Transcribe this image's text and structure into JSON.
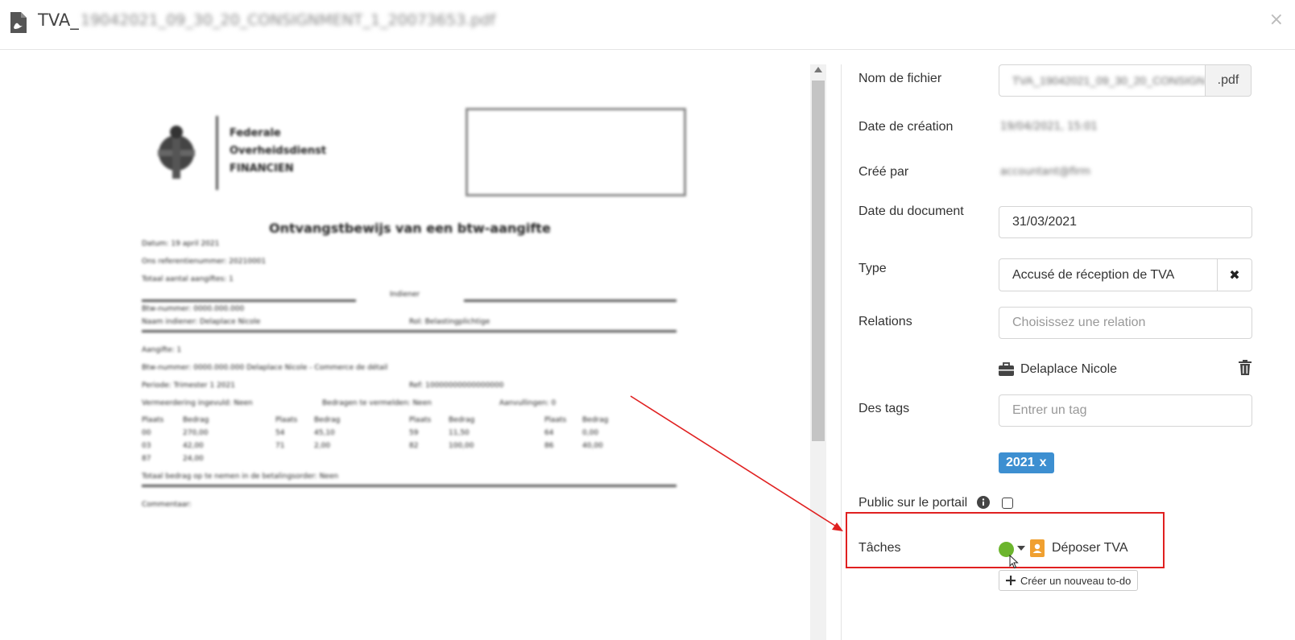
{
  "header": {
    "title_prefix": "TVA_",
    "title_blurred": "19042021_09_30_20_CONSIGNMENT_1_20073653.pdf",
    "close_symbol": "×"
  },
  "document": {
    "org_lines": [
      "Federale",
      "Overheidsdienst",
      "FINANCIEN"
    ],
    "heading": "Ontvangstbewijs van een btw-aangifte",
    "meta_lines": [
      "Datum: 19 april 2021",
      "Ons referentienummer: 20210001",
      "Totaal aantal aangiftes: 1"
    ],
    "section_label": "Indiener",
    "sender_number": "Btw-nummer: 0000.000.000",
    "sender_name": "Naam indiener: Delaplace Nicole",
    "sender_role": "Rol: Belastingplichtige",
    "return_label": "Aangifte: 1",
    "return_vat": "Btw-nummer: 0000.000.000 Delaplace Nicole - Commerce de détail",
    "period": "Periode: Trimester 1 2021",
    "ref": "Ref: 10000000000000000",
    "flags": [
      "Vermeerdering ingevuld: Neen",
      "Bedragen te vermelden: Neen",
      "Aanvullingen: 0"
    ],
    "grid_headers": [
      "Plaats",
      "Bedrag",
      "Plaats",
      "Bedrag",
      "Plaats",
      "Bedrag",
      "Plaats",
      "Bedrag"
    ],
    "grid_rows": [
      [
        "00",
        "270,00",
        "54",
        "45,10",
        "59",
        "11,50",
        "64",
        "0,00"
      ],
      [
        "03",
        "42,00",
        "71",
        "2,00",
        "82",
        "100,00",
        "86",
        "40,00"
      ],
      [
        "87",
        "24,00",
        "",
        "",
        "",
        "",
        "",
        ""
      ]
    ],
    "footer_line": "Totaal bedrag op te nemen in de betalingsorder: Neen",
    "signature": "Commentaar:"
  },
  "fields": {
    "filename_label": "Nom de fichier",
    "filename_value": "TVA_19042021_09_30_20_CONSIGN",
    "filename_ext": ".pdf",
    "created_date_label": "Date de création",
    "created_date_value": "19/04/2021, 15:01",
    "created_by_label": "Créé par",
    "created_by_value": "accountant@firm",
    "doc_date_label": "Date du document",
    "doc_date_value": "31/03/2021",
    "type_label": "Type",
    "type_value": "Accusé de réception de TVA",
    "type_clear": "✖",
    "relations_label": "Relations",
    "relations_placeholder": "Choisissez une relation",
    "relation_item": "Delaplace Nicole",
    "tags_label": "Des tags",
    "tags_placeholder": "Entrer un tag",
    "tag_value": "2021",
    "tag_remove": "x",
    "public_label": "Public sur le portail",
    "tasks_label": "Tâches",
    "task_name": "Déposer TVA",
    "create_todo_label": "Créer un nouveau to-do"
  },
  "icons": {
    "pdf": "pdf-file-icon",
    "briefcase": "briefcase-icon",
    "trash": "trash-icon",
    "info": "info-icon",
    "contact": "contact-card-icon",
    "plus": "plus-icon"
  },
  "colors": {
    "tag_bg": "#3d8fd1",
    "status_green": "#6cb52d",
    "contact_orange": "#f0a030",
    "highlight_red": "#e02020"
  }
}
